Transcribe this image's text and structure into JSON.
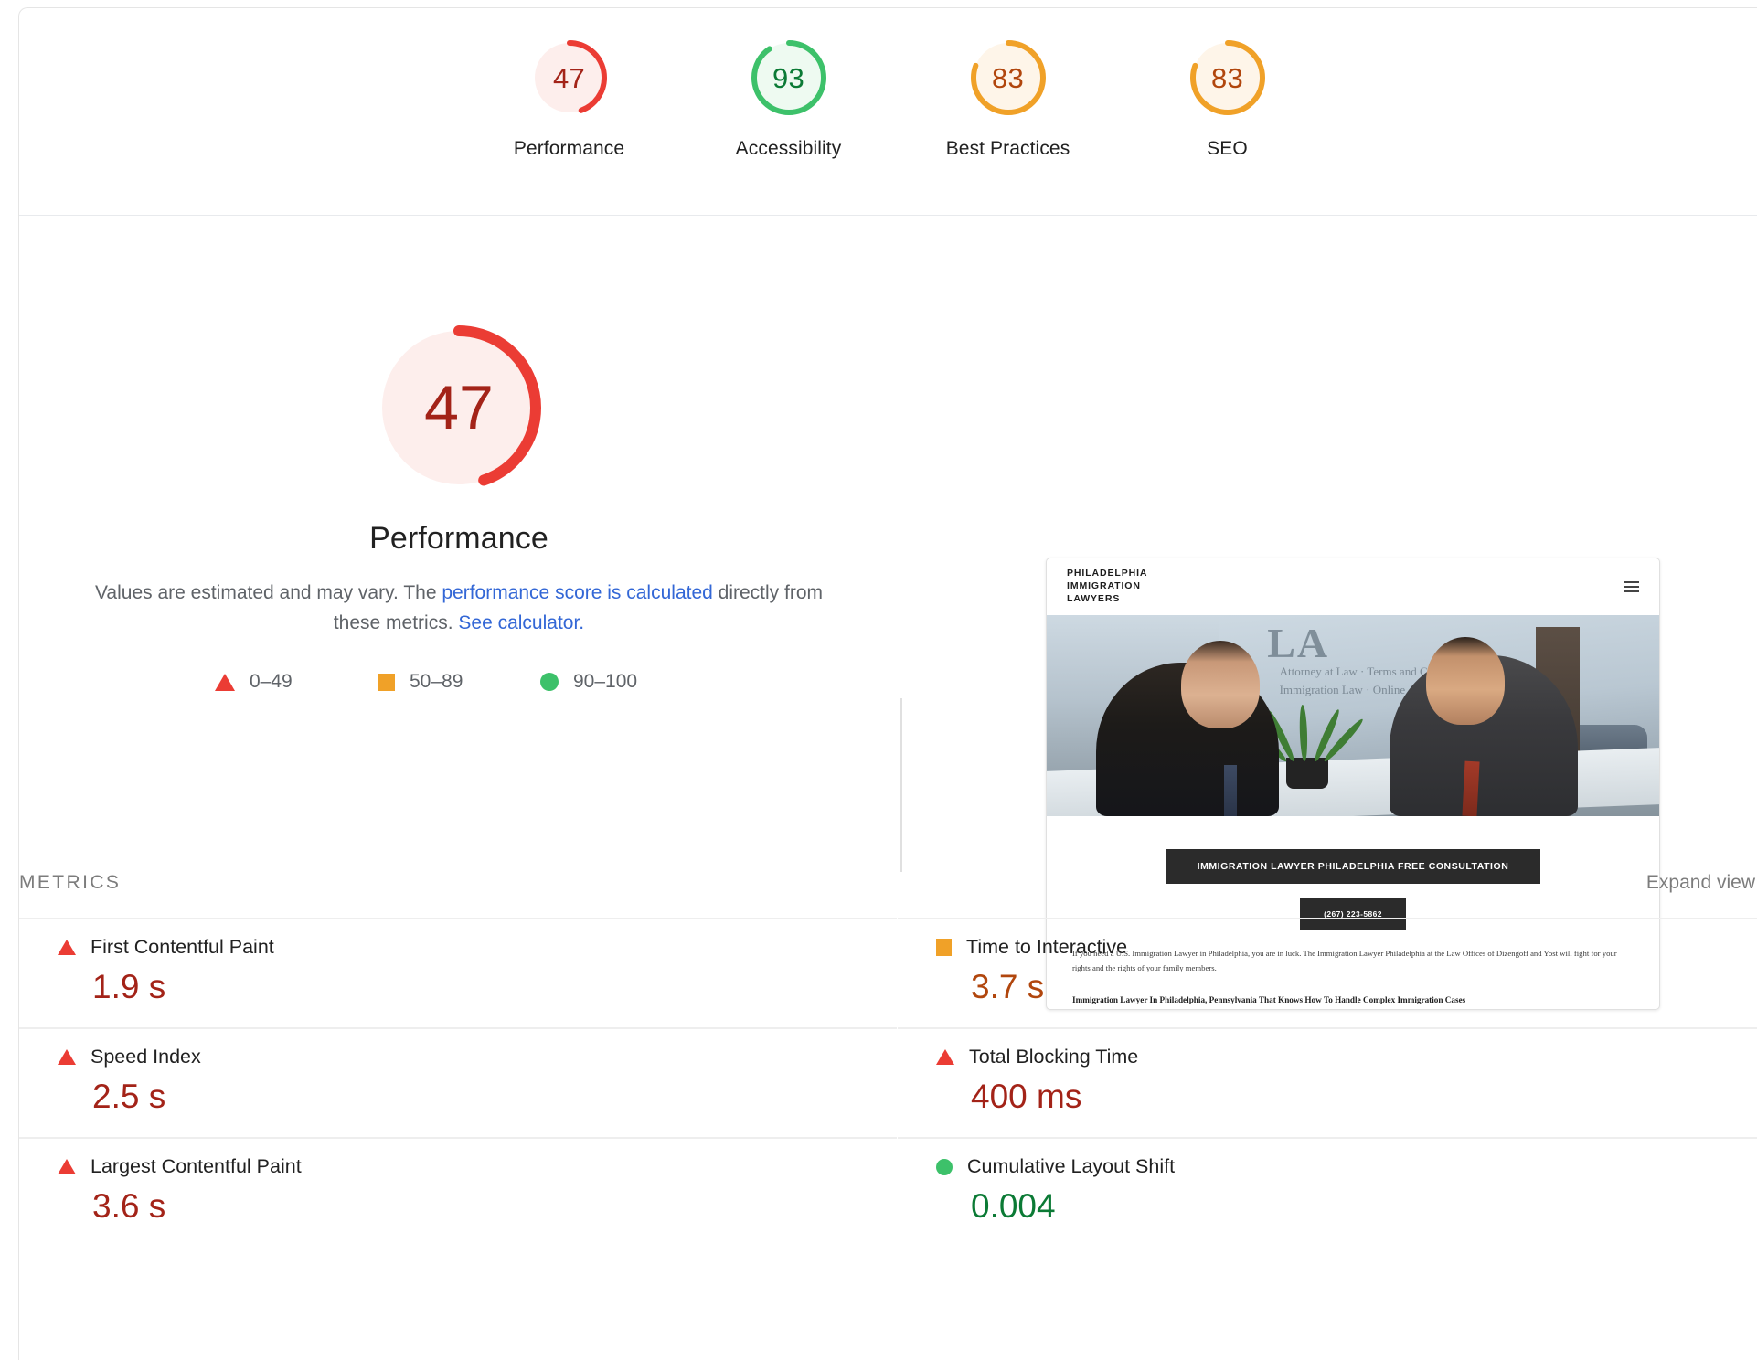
{
  "colors": {
    "fail": "#eb3c34",
    "fail_text": "#a32318",
    "average": "#f0a128",
    "average_text": "#b1460d",
    "pass": "#3dc16a",
    "pass_text": "#0b7a35",
    "fail_bg": "#fdeeec",
    "average_bg": "#fef5e9",
    "pass_bg": "#eefaf1",
    "link": "#3367d6",
    "muted": "#5f6368"
  },
  "gauges": [
    {
      "score": 47,
      "label": "Performance",
      "rating": "fail"
    },
    {
      "score": 93,
      "label": "Accessibility",
      "rating": "pass"
    },
    {
      "score": 83,
      "label": "Best Practices",
      "rating": "average"
    },
    {
      "score": 83,
      "label": "SEO",
      "rating": "average"
    }
  ],
  "performance": {
    "score": 47,
    "title": "Performance",
    "desc_part1": "Values are estimated and may vary. The ",
    "desc_link1": "performance score is calculated",
    "desc_part2": " directly from these metrics. ",
    "desc_link2": "See calculator.",
    "legend": [
      {
        "shape": "triangle",
        "range": "0–49",
        "rating": "fail"
      },
      {
        "shape": "square",
        "range": "50–89",
        "rating": "average"
      },
      {
        "shape": "circle",
        "range": "90–100",
        "rating": "pass"
      }
    ]
  },
  "thumbnail": {
    "brand_line1": "PHILADELPHIA",
    "brand_line2": "IMMIGRATION",
    "brand_line3": "LAWYERS",
    "menu_icon": "hamburger-icon",
    "hero_wordmark": "LA",
    "hero_glass_text": "Attorney at Law · Terms and Cases · Immigration Law · Online",
    "cta_main": "IMMIGRATION LAWYER PHILADELPHIA FREE CONSULTATION",
    "cta_phone": "(267) 223-5862",
    "paragraph": "If you need a U.S. Immigration Lawyer in Philadelphia, you are in luck. The Immigration Lawyer Philadelphia at the Law Offices of Dizengoff and Yost will fight for your rights and the rights of your family members.",
    "heading": "Immigration Lawyer In Philadelphia, Pennsylvania That Knows How To Handle Complex Immigration Cases"
  },
  "metrics_section": {
    "title": "METRICS",
    "expand_view": "Expand view"
  },
  "metrics_left": [
    {
      "shape": "triangle",
      "rating": "fail",
      "name": "First Contentful Paint",
      "value": "1.9 s"
    },
    {
      "shape": "triangle",
      "rating": "fail",
      "name": "Speed Index",
      "value": "2.5 s"
    },
    {
      "shape": "triangle",
      "rating": "fail",
      "name": "Largest Contentful Paint",
      "value": "3.6 s"
    }
  ],
  "metrics_right": [
    {
      "shape": "square",
      "rating": "average",
      "name": "Time to Interactive",
      "value": "3.7 s"
    },
    {
      "shape": "triangle",
      "rating": "fail",
      "name": "Total Blocking Time",
      "value": "400 ms"
    },
    {
      "shape": "circle",
      "rating": "pass",
      "name": "Cumulative Layout Shift",
      "value": "0.004"
    }
  ]
}
